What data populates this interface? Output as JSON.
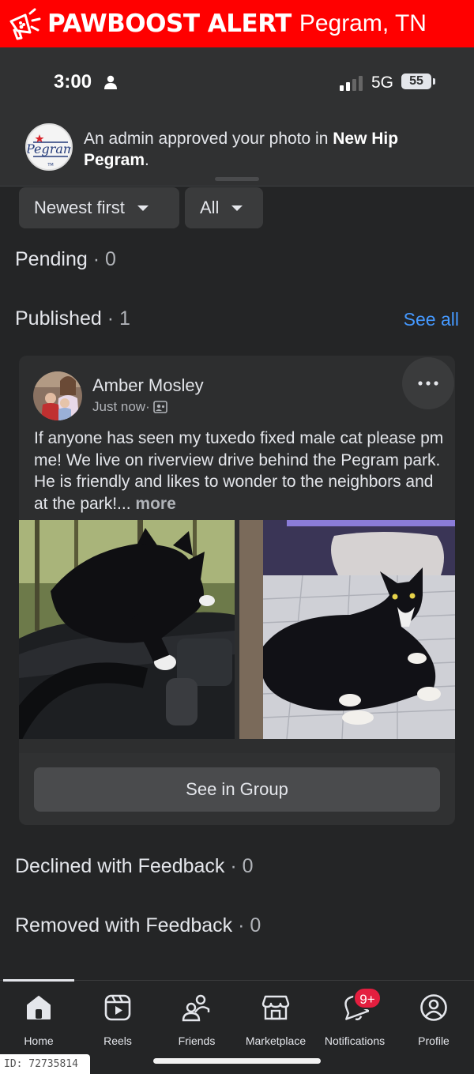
{
  "alert": {
    "brand": "PAWBOOST ALERT",
    "location": "Pegram, TN"
  },
  "status_bar": {
    "time": "3:00",
    "network": "5G",
    "battery": "55"
  },
  "notification": {
    "text_prefix": "An admin approved your photo in ",
    "group_name": "New Hip Pegram",
    "text_suffix": ".",
    "avatar_logo_text": "Pegram"
  },
  "filters": {
    "sort": "Newest first",
    "scope": "All"
  },
  "sections": {
    "pending": {
      "label": "Pending",
      "sep": " · ",
      "count": "0"
    },
    "published": {
      "label": "Published",
      "sep": " · ",
      "count": "1",
      "see_all": "See all"
    },
    "declined": {
      "label": "Declined with Feedback",
      "sep": " · ",
      "count": "0"
    },
    "removed": {
      "label": "Removed with Feedback",
      "sep": " · ",
      "count": "0"
    }
  },
  "post": {
    "author": "Amber Mosley",
    "time": "Just now",
    "time_sep": " · ",
    "body": "If anyone has seen my tuxedo fixed male cat please pm me! We live on riverview drive behind the Pegram park. He is friendly and likes to wonder to the neighbors and at the park!... ",
    "more_label": "more",
    "see_in_group": "See in Group"
  },
  "tabs": [
    {
      "label": "Home",
      "icon": "home-icon"
    },
    {
      "label": "Reels",
      "icon": "reels-icon"
    },
    {
      "label": "Friends",
      "icon": "friends-icon"
    },
    {
      "label": "Marketplace",
      "icon": "marketplace-icon"
    },
    {
      "label": "Notifications",
      "icon": "bell-icon",
      "badge": "9+"
    },
    {
      "label": "Profile",
      "icon": "profile-icon"
    }
  ],
  "id_label": "ID: 72735814",
  "colors": {
    "alert_red": "#ff0000",
    "link_blue": "#4599ff",
    "badge_red": "#e41e3f",
    "background": "#242526"
  }
}
